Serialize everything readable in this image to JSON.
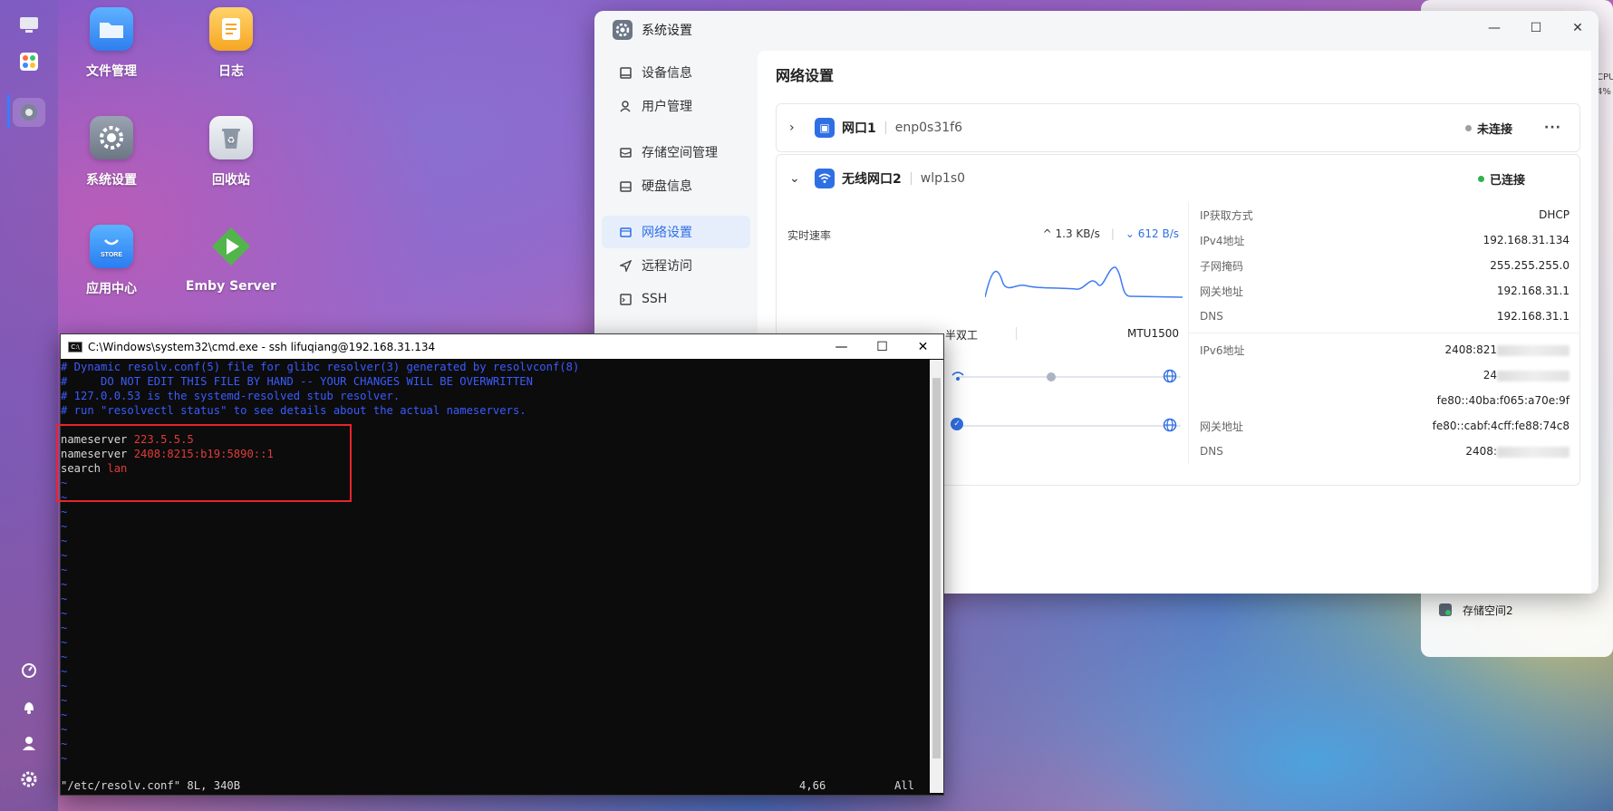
{
  "dock": {
    "items": [
      "desktop-icon",
      "apps-grid-icon",
      "settings-icon"
    ],
    "bottom_items": [
      "speed-icon",
      "bell-icon",
      "user-icon",
      "gear-icon"
    ]
  },
  "desktop": {
    "icons": [
      {
        "label": "文件管理",
        "icon": "folder-icon"
      },
      {
        "label": "日志",
        "icon": "log-icon"
      },
      {
        "label": "系统设置",
        "icon": "settings-icon"
      },
      {
        "label": "回收站",
        "icon": "recycle-icon"
      },
      {
        "label": "应用中心",
        "icon": "store-icon",
        "sub": "STORE"
      },
      {
        "label": "Emby Server",
        "icon": "play-icon"
      }
    ]
  },
  "settings": {
    "title": "系统设置",
    "sidebar": [
      {
        "label": "设备信息",
        "icon": "device-icon"
      },
      {
        "label": "用户管理",
        "icon": "user-icon"
      },
      {
        "label": "存储空间管理",
        "icon": "storage-icon"
      },
      {
        "label": "硬盘信息",
        "icon": "disk-icon"
      },
      {
        "label": "网络设置",
        "icon": "network-icon",
        "active": true
      },
      {
        "label": "远程访问",
        "icon": "remote-icon"
      },
      {
        "label": "SSH",
        "icon": "ssh-icon"
      }
    ],
    "page_title": "网络设置",
    "port1": {
      "name": "网口1",
      "iface": "enp0s31f6",
      "status": "未连接",
      "status_color": "#9aa0a6"
    },
    "port2": {
      "name": "无线网口2",
      "iface": "wlp1s0",
      "status": "已连接",
      "status_color": "#2fb24c",
      "speed_label": "实时速率",
      "up": "1.3 KB/s",
      "down": "612 B/s",
      "duplex": "半双工",
      "mtu": "MTU1500",
      "info": [
        {
          "k": "IP获取方式",
          "v": "DHCP"
        },
        {
          "k": "IPv4地址",
          "v": "192.168.31.134"
        },
        {
          "k": "子网掩码",
          "v": "255.255.255.0"
        },
        {
          "k": "网关地址",
          "v": "192.168.31.1"
        },
        {
          "k": "DNS",
          "v": "192.168.31.1"
        }
      ],
      "info6": [
        {
          "k": "IPv6地址",
          "v": "2408:821"
        },
        {
          "k": "",
          "v": "24"
        },
        {
          "k": "",
          "v": "fe80::40ba:f065:a70e:9f"
        },
        {
          "k": "网关地址",
          "v": "fe80::cabf:4cff:fe88:74c8"
        },
        {
          "k": "DNS",
          "v": "2408:"
        }
      ]
    }
  },
  "terminal": {
    "title": "C:\\Windows\\system32\\cmd.exe - ssh  lifuqiang@192.168.31.134",
    "comments": [
      "# Dynamic resolv.conf(5) file for glibc resolver(3) generated by resolvconf(8)",
      "#     DO NOT EDIT THIS FILE BY HAND -- YOUR CHANGES WILL BE OVERWRITTEN",
      "# 127.0.0.53 is the systemd-resolved stub resolver.",
      "# run \"resolvectl status\" to see details about the actual nameservers."
    ],
    "entries": [
      {
        "key": "nameserver",
        "val": "223.5.5.5"
      },
      {
        "key": "nameserver",
        "val": "2408:8215:b19:5890::1"
      },
      {
        "key": "search",
        "val": "lan"
      }
    ],
    "status_file": "\"/etc/resolv.conf\" 8L, 340B",
    "status_pos": "4,66",
    "status_all": "All"
  },
  "widget": {
    "cpu_label": "CPU",
    "cpu_pct": "4%",
    "storage_label": "存储空间2"
  }
}
